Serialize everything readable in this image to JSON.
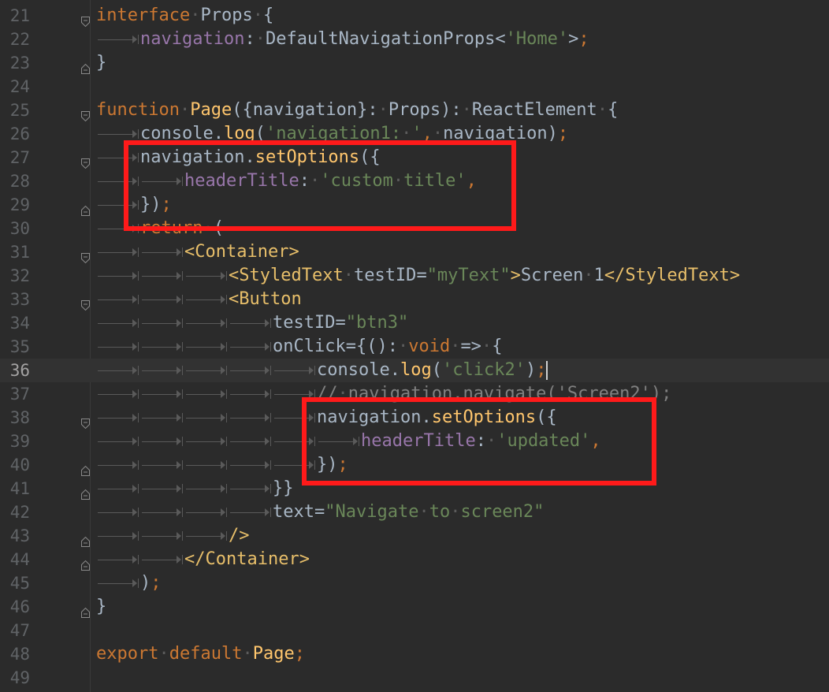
{
  "editor": {
    "language": "TypeScript (TSX)",
    "current_line": 36,
    "lines": [
      {
        "num": "21",
        "tokens": [
          {
            "t": "interface",
            "c": "kw"
          },
          {
            "t": " ",
            "c": "dt"
          },
          {
            "t": "Props",
            "c": "tx"
          },
          {
            "t": " ",
            "c": "dt"
          },
          {
            "t": "{",
            "c": "tx"
          }
        ]
      },
      {
        "num": "22",
        "tokens": [
          {
            "t": "navigation",
            "c": "pr"
          },
          {
            "t": ":",
            "c": "tx"
          },
          {
            "t": " ",
            "c": "dt"
          },
          {
            "t": "DefaultNavigationProps<",
            "c": "tx"
          },
          {
            "t": "'Home'",
            "c": "st"
          },
          {
            "t": ">",
            "c": "tx"
          },
          {
            "t": ";",
            "c": "kw"
          }
        ]
      },
      {
        "num": "23",
        "tokens": [
          {
            "t": "}",
            "c": "tx"
          }
        ]
      },
      {
        "num": "24",
        "tokens": []
      },
      {
        "num": "25",
        "tokens": [
          {
            "t": "function",
            "c": "kw"
          },
          {
            "t": " ",
            "c": "dt"
          },
          {
            "t": "Page",
            "c": "fn"
          },
          {
            "t": "({navigation}:",
            "c": "tx"
          },
          {
            "t": " ",
            "c": "dt"
          },
          {
            "t": "Props):",
            "c": "tx"
          },
          {
            "t": " ",
            "c": "dt"
          },
          {
            "t": "ReactElement",
            "c": "tx"
          },
          {
            "t": " ",
            "c": "dt"
          },
          {
            "t": "{",
            "c": "tx"
          }
        ]
      },
      {
        "num": "26",
        "tokens": [
          {
            "t": "console.",
            "c": "tx"
          },
          {
            "t": "log",
            "c": "fn"
          },
          {
            "t": "(",
            "c": "tx"
          },
          {
            "t": "'navigation1:",
            "c": "st"
          },
          {
            "t": " ",
            "c": "dt"
          },
          {
            "t": "'",
            "c": "st"
          },
          {
            "t": ",",
            "c": "kw"
          },
          {
            "t": " ",
            "c": "dt"
          },
          {
            "t": "navigation)",
            "c": "tx"
          },
          {
            "t": ";",
            "c": "kw"
          }
        ]
      },
      {
        "num": "27",
        "tokens": [
          {
            "t": "navigation.",
            "c": "tx"
          },
          {
            "t": "setOptions",
            "c": "fn"
          },
          {
            "t": "({",
            "c": "tx"
          }
        ]
      },
      {
        "num": "28",
        "tokens": [
          {
            "t": "headerTitle",
            "c": "pr"
          },
          {
            "t": ":",
            "c": "tx"
          },
          {
            "t": " ",
            "c": "dt"
          },
          {
            "t": "'custom",
            "c": "st"
          },
          {
            "t": " ",
            "c": "dt"
          },
          {
            "t": "title'",
            "c": "st"
          },
          {
            "t": ",",
            "c": "kw"
          }
        ]
      },
      {
        "num": "29",
        "tokens": [
          {
            "t": "})",
            "c": "tx"
          },
          {
            "t": ";",
            "c": "kw"
          }
        ]
      },
      {
        "num": "30",
        "tokens": [
          {
            "t": "return",
            "c": "kw"
          },
          {
            "t": " ",
            "c": "dt"
          },
          {
            "t": "(",
            "c": "tx"
          }
        ]
      },
      {
        "num": "31",
        "tokens": [
          {
            "t": "<Container>",
            "c": "tg"
          }
        ]
      },
      {
        "num": "32",
        "tokens": [
          {
            "t": "<StyledText",
            "c": "tg"
          },
          {
            "t": " ",
            "c": "dt"
          },
          {
            "t": "testID",
            "c": "tx"
          },
          {
            "t": "=",
            "c": "tx"
          },
          {
            "t": "\"myText\"",
            "c": "st"
          },
          {
            "t": ">",
            "c": "tg"
          },
          {
            "t": "Screen",
            "c": "tx"
          },
          {
            "t": " ",
            "c": "dt"
          },
          {
            "t": "1",
            "c": "tx"
          },
          {
            "t": "</StyledText>",
            "c": "tg"
          }
        ]
      },
      {
        "num": "33",
        "tokens": [
          {
            "t": "<Button",
            "c": "tg"
          }
        ]
      },
      {
        "num": "34",
        "tokens": [
          {
            "t": "testID",
            "c": "tx"
          },
          {
            "t": "=",
            "c": "tx"
          },
          {
            "t": "\"btn3\"",
            "c": "st"
          }
        ]
      },
      {
        "num": "35",
        "tokens": [
          {
            "t": "onClick",
            "c": "tx"
          },
          {
            "t": "={():",
            "c": "tx"
          },
          {
            "t": " ",
            "c": "dt"
          },
          {
            "t": "void",
            "c": "kw"
          },
          {
            "t": " ",
            "c": "dt"
          },
          {
            "t": "=>",
            "c": "tx"
          },
          {
            "t": " ",
            "c": "dt"
          },
          {
            "t": "{",
            "c": "tx"
          }
        ]
      },
      {
        "num": "36",
        "tokens": [
          {
            "t": "console.",
            "c": "tx"
          },
          {
            "t": "log",
            "c": "fn"
          },
          {
            "t": "(",
            "c": "tx"
          },
          {
            "t": "'click2'",
            "c": "st"
          },
          {
            "t": ")",
            "c": "tx"
          },
          {
            "t": ";",
            "c": "kw"
          }
        ]
      },
      {
        "num": "37",
        "tokens": [
          {
            "t": "//",
            "c": "cm"
          },
          {
            "t": " ",
            "c": "dt"
          },
          {
            "t": "navigation.navigate('Screen2');",
            "c": "cm"
          }
        ]
      },
      {
        "num": "38",
        "tokens": [
          {
            "t": "navigation.",
            "c": "tx"
          },
          {
            "t": "setOptions",
            "c": "fn"
          },
          {
            "t": "({",
            "c": "tx"
          }
        ]
      },
      {
        "num": "39",
        "tokens": [
          {
            "t": "headerTitle",
            "c": "pr"
          },
          {
            "t": ":",
            "c": "tx"
          },
          {
            "t": " ",
            "c": "dt"
          },
          {
            "t": "'updated'",
            "c": "st"
          },
          {
            "t": ",",
            "c": "kw"
          }
        ]
      },
      {
        "num": "40",
        "tokens": [
          {
            "t": "})",
            "c": "tx"
          },
          {
            "t": ";",
            "c": "kw"
          }
        ]
      },
      {
        "num": "41",
        "tokens": [
          {
            "t": "}}",
            "c": "tx"
          }
        ]
      },
      {
        "num": "42",
        "tokens": [
          {
            "t": "text",
            "c": "tx"
          },
          {
            "t": "=",
            "c": "tx"
          },
          {
            "t": "\"Navigate",
            "c": "st"
          },
          {
            "t": " ",
            "c": "dt"
          },
          {
            "t": "to",
            "c": "st"
          },
          {
            "t": " ",
            "c": "dt"
          },
          {
            "t": "screen2\"",
            "c": "st"
          }
        ]
      },
      {
        "num": "43",
        "tokens": [
          {
            "t": "/>",
            "c": "tg"
          }
        ]
      },
      {
        "num": "44",
        "tokens": [
          {
            "t": "</Container>",
            "c": "tg"
          }
        ]
      },
      {
        "num": "45",
        "tokens": [
          {
            "t": ")",
            "c": "tx"
          },
          {
            "t": ";",
            "c": "kw"
          }
        ]
      },
      {
        "num": "46",
        "tokens": [
          {
            "t": "}",
            "c": "tx"
          }
        ]
      },
      {
        "num": "47",
        "tokens": []
      },
      {
        "num": "48",
        "tokens": [
          {
            "t": "export",
            "c": "kw"
          },
          {
            "t": " ",
            "c": "dt"
          },
          {
            "t": "default",
            "c": "kw"
          },
          {
            "t": " ",
            "c": "dt"
          },
          {
            "t": "Page",
            "c": "fn"
          },
          {
            "t": ";",
            "c": "kw"
          }
        ]
      },
      {
        "num": "49",
        "tokens": []
      }
    ]
  },
  "colors": {
    "background": "#2b2b2b",
    "keyword": "#cc7832",
    "function": "#ffc66d",
    "text": "#a9b7c6",
    "property": "#9876aa",
    "string": "#6a8759",
    "tag": "#e8bf6a",
    "comment": "#808080",
    "line_number": "#606366",
    "highlight_box": "#ff1a1a"
  },
  "icons": [
    "fold-open-icon",
    "fold-close-icon",
    "tab-arrow-icon"
  ]
}
